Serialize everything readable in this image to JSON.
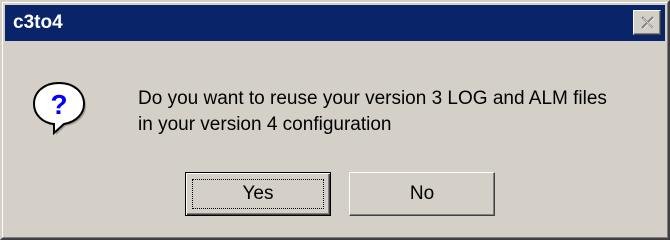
{
  "window": {
    "title": "c3to4"
  },
  "titlebar": {
    "close_icon": "close-icon"
  },
  "message": {
    "icon": "question-icon",
    "line1": "Do you want to reuse your version 3 LOG and ALM files",
    "line2": "in your version 4 configuration"
  },
  "buttons": {
    "yes_label": "Yes",
    "no_label": "No"
  },
  "colors": {
    "titlebar": "#0a246a",
    "dialog_face": "#d4d0c8",
    "icon_question": "#0000ff"
  }
}
